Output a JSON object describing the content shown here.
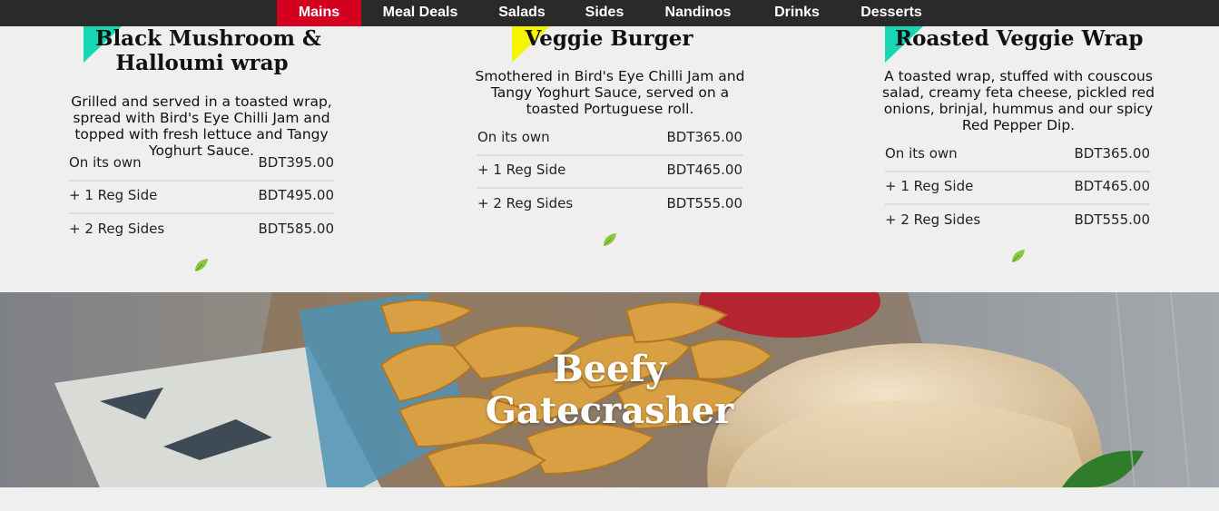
{
  "nav": {
    "items": [
      "Mains",
      "Meal Deals",
      "Salads",
      "Sides",
      "Nandinos",
      "Drinks",
      "Desserts"
    ],
    "active": "Mains"
  },
  "colors": {
    "navbar": "#2a2a2a",
    "active_tab": "#d4001f",
    "teal_accent": "#17d6b4",
    "yellow_accent": "#f5f500",
    "leaf_green": "#8cc63f"
  },
  "cards": [
    {
      "title_line1": "Black Mushroom &",
      "title_line2": "Halloumi wrap",
      "accent_color": "#17d6b4",
      "description": "Grilled and served in a toasted wrap, spread with Bird's Eye Chilli Jam and topped with fresh lettuce and Tangy Yoghurt Sauce.",
      "prices": [
        {
          "label": "On its own",
          "price": "BDT395.00"
        },
        {
          "label": "+ 1 Reg Side",
          "price": "BDT495.00"
        },
        {
          "label": "+ 2 Reg Sides",
          "price": "BDT585.00"
        }
      ],
      "icon": "vegetarian-leaf-icon"
    },
    {
      "title_line1": "Veggie Burger",
      "accent_color": "#f5f500",
      "description": "Smothered in Bird's Eye Chilli Jam and Tangy Yoghurt Sauce, served on a toasted Portuguese roll.",
      "prices": [
        {
          "label": "On its own",
          "price": "BDT365.00"
        },
        {
          "label": "+ 1 Reg Side",
          "price": "BDT465.00"
        },
        {
          "label": "+ 2 Reg Sides",
          "price": "BDT555.00"
        }
      ],
      "icon": "vegetarian-leaf-icon"
    },
    {
      "title_line1": "Roasted Veggie Wrap",
      "accent_color": "#17d6b4",
      "description": "A toasted wrap, stuffed with couscous salad, creamy feta cheese, pickled red onions, brinjal, hummus and our spicy Red Pepper Dip.",
      "prices": [
        {
          "label": "On its own",
          "price": "BDT365.00"
        },
        {
          "label": "+ 1 Reg Side",
          "price": "BDT465.00"
        },
        {
          "label": "+ 2 Reg Sides",
          "price": "BDT555.00"
        }
      ],
      "icon": "vegetarian-leaf-icon"
    }
  ],
  "banner": {
    "title_line1": "Beefy",
    "title_line2": "Gatecrasher"
  }
}
